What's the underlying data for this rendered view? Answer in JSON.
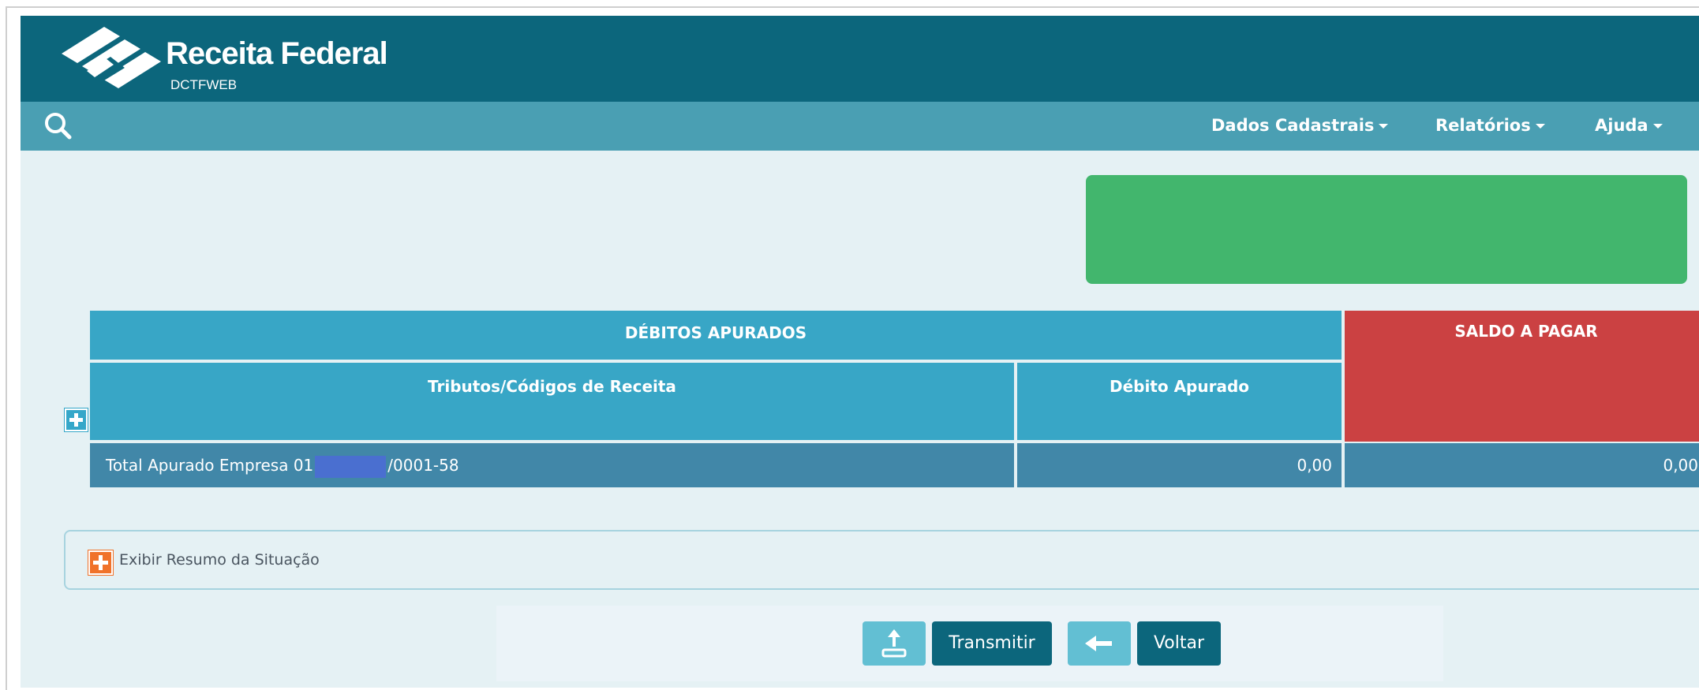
{
  "header": {
    "brand_title": "Receita Federal",
    "brand_subtitle": "DCTFWEB"
  },
  "navbar": {
    "search_icon": "search-icon",
    "items": [
      {
        "label": "Dados Cadastrais"
      },
      {
        "label": "Relatórios"
      },
      {
        "label": "Ajuda"
      }
    ]
  },
  "table": {
    "header_debitos": "DÉBITOS APURADOS",
    "header_saldo": "SALDO A PAGAR",
    "col_tributos": "Tributos/Códigos de Receita",
    "col_debito": "Débito Apurado",
    "row": {
      "label_prefix": "Total Apurado Empresa 01",
      "label_suffix": "/0001-58",
      "debito": "0,00",
      "saldo": "0,00"
    }
  },
  "resumo": {
    "label": "Exibir Resumo da Situação"
  },
  "actions": {
    "transmitir": "Transmitir",
    "voltar": "Voltar"
  },
  "colors": {
    "header_bg": "#0c667c",
    "navbar_bg": "#4a9fb3",
    "status_green": "#42b66d",
    "table_header": "#38a6c6",
    "saldo_red": "#cb4142",
    "row_bg": "#4187a8",
    "orange_icon": "#f0722a"
  }
}
